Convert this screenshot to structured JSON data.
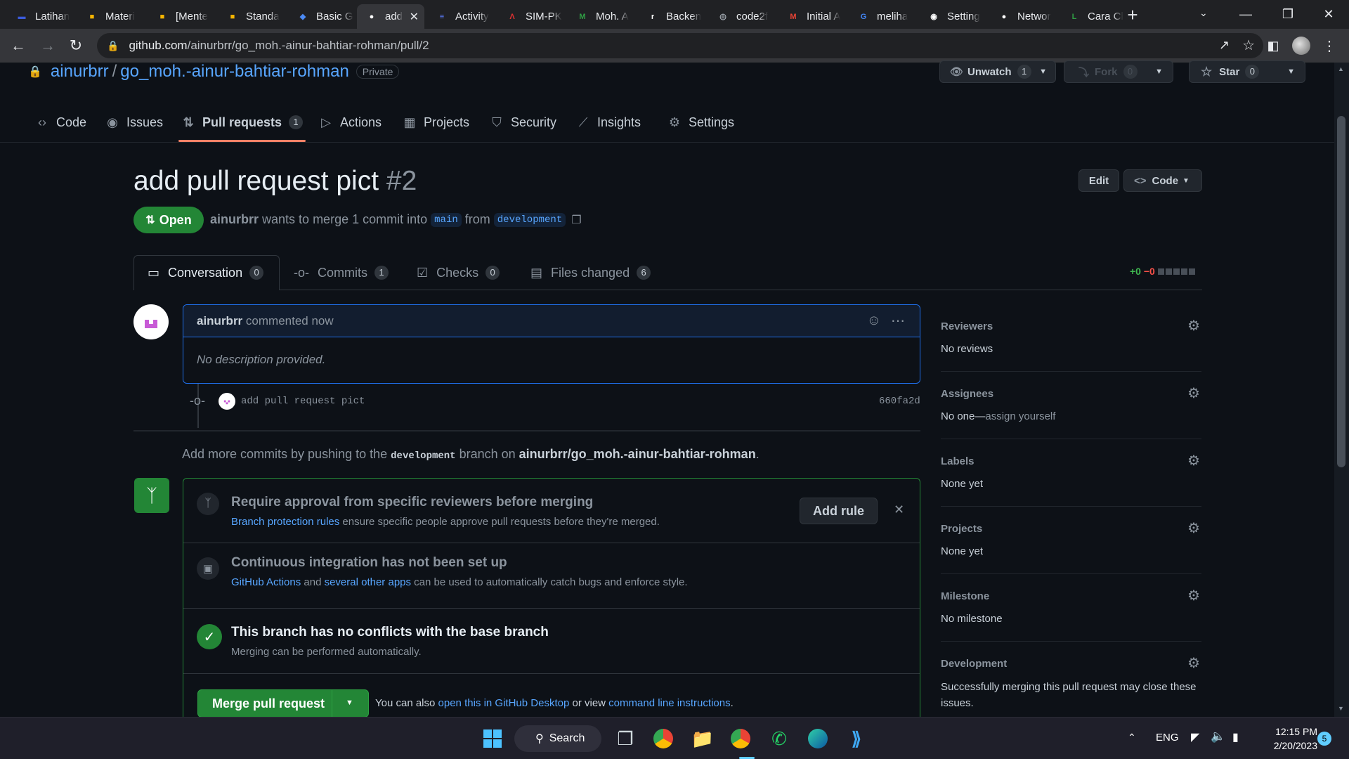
{
  "browser": {
    "tabs": [
      {
        "label": "Latihan",
        "icon": "bar-icon",
        "color": "#3b5bdb"
      },
      {
        "label": "Materi",
        "icon": "slides-icon",
        "color": "#f4b400"
      },
      {
        "label": "[Mente",
        "icon": "slides-icon",
        "color": "#f4b400"
      },
      {
        "label": "Standa",
        "icon": "slides-icon",
        "color": "#f4b400"
      },
      {
        "label": "Basic G",
        "icon": "blue-logo-icon",
        "color": "#4c8bf5"
      },
      {
        "label": "add",
        "icon": "github-icon",
        "color": "#ffffff"
      },
      {
        "label": "Activity",
        "icon": "stripes-icon",
        "color": "#5b7cfa"
      },
      {
        "label": "SIM-PK",
        "icon": "red-a-icon",
        "color": "#e03131"
      },
      {
        "label": "Moh. A",
        "icon": "m-icon",
        "color": "#2f9e44"
      },
      {
        "label": "Backen",
        "icon": "r-icon",
        "color": "#ffffff"
      },
      {
        "label": "code2f",
        "icon": "globe-icon",
        "color": "#adb5bd"
      },
      {
        "label": "Initial A",
        "icon": "gmail-icon",
        "color": "#ea4335"
      },
      {
        "label": "meliha",
        "icon": "google-icon",
        "color": "#4285f4"
      },
      {
        "label": "Setting",
        "icon": "meet-icon",
        "color": "#ffffff"
      },
      {
        "label": "Networ",
        "icon": "github-icon",
        "color": "#ffffff"
      },
      {
        "label": "Cara Cl",
        "icon": "green-l-icon",
        "color": "#2f9e44"
      }
    ],
    "url_domain": "github.com",
    "url_path": "/ainurbrr/go_moh.-ainur-bahtiar-rohman/pull/2"
  },
  "repo": {
    "owner": "ainurbrr",
    "separator": "/",
    "name": "go_moh.-ainur-bahtiar-rohman",
    "visibility": "Private",
    "unwatch_label": "Unwatch",
    "unwatch_count": "1",
    "fork_label": "Fork",
    "fork_count": "0",
    "star_label": "Star",
    "star_count": "0"
  },
  "repo_nav": [
    {
      "label": "Code",
      "icon": "code-icon"
    },
    {
      "label": "Issues",
      "icon": "issue-icon"
    },
    {
      "label": "Pull requests",
      "icon": "pull-request-icon",
      "count": "1"
    },
    {
      "label": "Actions",
      "icon": "play-icon"
    },
    {
      "label": "Projects",
      "icon": "table-icon"
    },
    {
      "label": "Security",
      "icon": "shield-icon"
    },
    {
      "label": "Insights",
      "icon": "graph-icon"
    },
    {
      "label": "Settings",
      "icon": "gear-icon"
    }
  ],
  "pr": {
    "title": "add pull request pict",
    "number": "#2",
    "edit_label": "Edit",
    "code_label": "Code",
    "state": "Open",
    "author": "ainurbrr",
    "merge_text": "wants to merge 1 commit into",
    "base_branch": "main",
    "from_text": "from",
    "head_branch": "development",
    "tabs": [
      {
        "label": "Conversation",
        "count": "0",
        "icon": "comment-icon"
      },
      {
        "label": "Commits",
        "count": "1",
        "icon": "commit-icon"
      },
      {
        "label": "Checks",
        "count": "0",
        "icon": "checklist-icon"
      },
      {
        "label": "Files changed",
        "count": "6",
        "icon": "file-diff-icon"
      }
    ],
    "diff_add": "+0",
    "diff_del": "−0"
  },
  "comment": {
    "author": "ainurbrr",
    "meta": "commented now",
    "body": "No description provided."
  },
  "commit": {
    "message": "add pull request pict",
    "sha": "660fa2d"
  },
  "push_hint": {
    "prefix": "Add more commits by pushing to the",
    "branch": "development",
    "mid": "branch on",
    "repo": "ainurbrr/go_moh.-ainur-bahtiar-rohman",
    "suffix": "."
  },
  "merge_box": {
    "rule_title": "Require approval from specific reviewers before merging",
    "rule_link": "Branch protection rules",
    "rule_text": "ensure specific people approve pull requests before they're merged.",
    "add_rule_label": "Add rule",
    "ci_title": "Continuous integration has not been set up",
    "ci_link1": "GitHub Actions",
    "ci_and": "and",
    "ci_link2": "several other apps",
    "ci_text": "can be used to automatically catch bugs and enforce style.",
    "conflict_title": "This branch has no conflicts with the base branch",
    "conflict_text": "Merging can be performed automatically.",
    "merge_button": "Merge pull request",
    "also_text": "You can also",
    "desktop_link": "open this in GitHub Desktop",
    "or_view": "or view",
    "cli_link": "command line instructions",
    "end": "."
  },
  "sidebar": {
    "reviewers_title": "Reviewers",
    "reviewers_value": "No reviews",
    "assignees_title": "Assignees",
    "assignees_value": "No one—",
    "assign_yourself": "assign yourself",
    "labels_title": "Labels",
    "labels_value": "None yet",
    "projects_title": "Projects",
    "projects_value": "None yet",
    "milestone_title": "Milestone",
    "milestone_value": "No milestone",
    "development_title": "Development",
    "development_value": "Successfully merging this pull request may close these issues."
  },
  "taskbar": {
    "search_label": "Search",
    "lang": "ENG",
    "time": "12:15 PM",
    "date": "2/20/2023",
    "notif_count": "5"
  },
  "colors": {
    "accent": "#58a6ff",
    "open_green": "#238636",
    "bg": "#0d1117",
    "nav_underline": "#f78166"
  }
}
